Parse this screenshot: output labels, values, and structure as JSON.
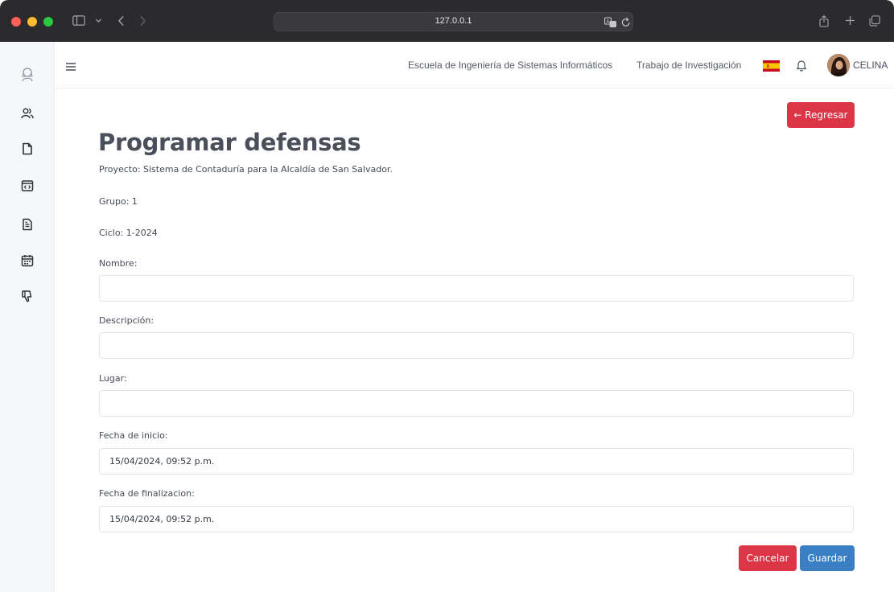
{
  "browser": {
    "address": "127.0.0.1"
  },
  "header": {
    "school_link": "Escuela de Ingeniería de Sistemas Informáticos",
    "research_link": "Trabajo de Investigación",
    "user_name": "CELINA"
  },
  "page": {
    "back_button": "← Regresar",
    "title": "Programar defensas",
    "project": "Proyecto: Sistema de Contaduría para la Alcaldía de San Salvador.",
    "group": "Grupo: 1",
    "cycle": "Ciclo: 1-2024"
  },
  "form": {
    "name_label": "Nombre:",
    "name_value": "",
    "description_label": "Descripción:",
    "description_value": "",
    "place_label": "Lugar:",
    "place_value": "",
    "start_label": "Fecha de inicio:",
    "start_value": "15/04/2024, 09:52 p.m.",
    "end_label": "Fecha de finalizacion:",
    "end_value": "15/04/2024, 09:52 p.m.",
    "cancel_button": "Cancelar",
    "save_button": "Guardar"
  },
  "sidebar_icons": [
    "logo-icon",
    "users-icon",
    "file-icon",
    "code-window-icon",
    "document-icon",
    "calendar-icon",
    "thumbs-down-icon"
  ],
  "colors": {
    "danger": "#dc3545",
    "primary": "#3a7fc4"
  }
}
